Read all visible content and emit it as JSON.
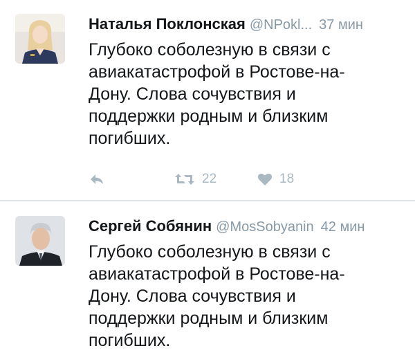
{
  "tweets": [
    {
      "name": "Наталья Поклонская",
      "handle": "@NPokl...",
      "time": "37 мин",
      "text": "Глубоко соболезную в связи с авиакатастрофой в Ростове-на-Дону. Слова сочувствия и поддержки родным и близким погибших.",
      "retweets": "22",
      "likes": "18"
    },
    {
      "name": "Сергей Собянин",
      "handle": "@MosSobyanin",
      "time": "42 мин",
      "text": "Глубоко соболезную в связи с авиакатастрофой в Ростове-на-Дону. Слова сочувствия и поддержки родным и близким погибших."
    }
  ],
  "icons": {
    "reply": "reply-icon",
    "retweet": "retweet-icon",
    "like": "heart-icon"
  },
  "colors": {
    "name": "#14171a",
    "meta": "#8899a6",
    "action": "#aab8c2",
    "divider": "#dfe4e8"
  }
}
